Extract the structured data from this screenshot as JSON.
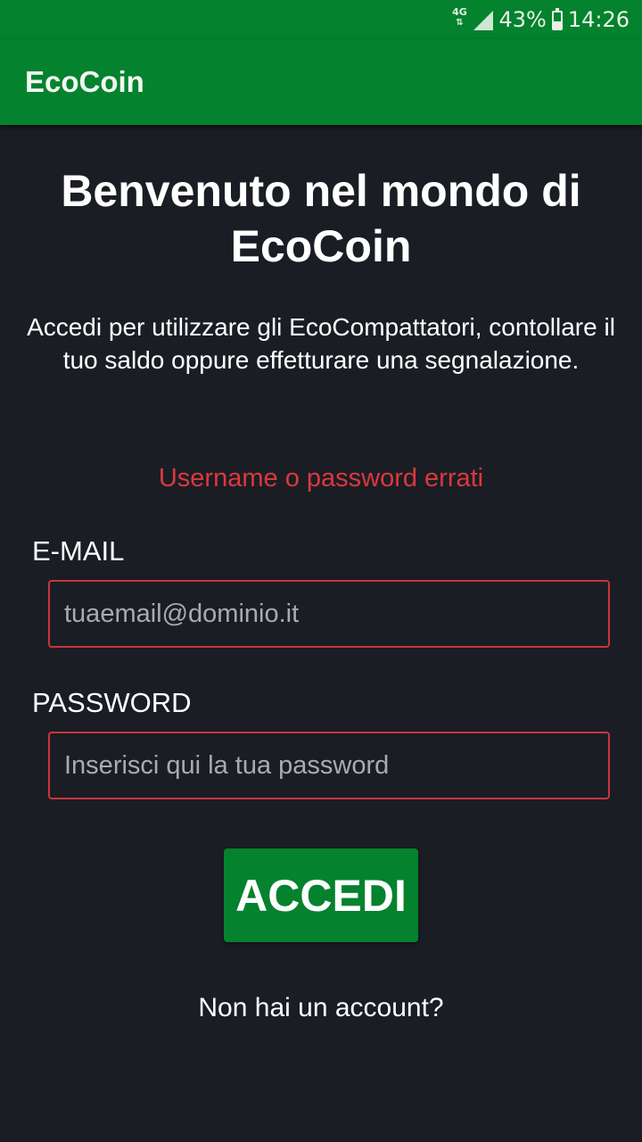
{
  "status_bar": {
    "network": "4G",
    "battery": "43%",
    "battery_level": 0.43,
    "time": "14:26",
    "icons": [
      "network-4g-icon",
      "signal-icon",
      "battery-icon"
    ]
  },
  "app_bar": {
    "title": "EcoCoin",
    "color": "#05822e"
  },
  "main": {
    "title": "Benvenuto nel mondo di EcoCoin",
    "subtitle": "Accedi per utilizzare gli EcoCompattatori, contollare il tuo saldo oppure effetturare una segnalazione.",
    "error": "Username o password errati",
    "error_color": "#d9393e"
  },
  "form": {
    "email_label": "E-MAIL",
    "email_placeholder": "tuaemail@dominio.it",
    "email_value": "",
    "password_label": "PASSWORD",
    "password_placeholder": "Inserisci qui la tua password",
    "password_value": "",
    "submit_label": "ACCEDI",
    "signup_link": "Non hai un account?"
  }
}
